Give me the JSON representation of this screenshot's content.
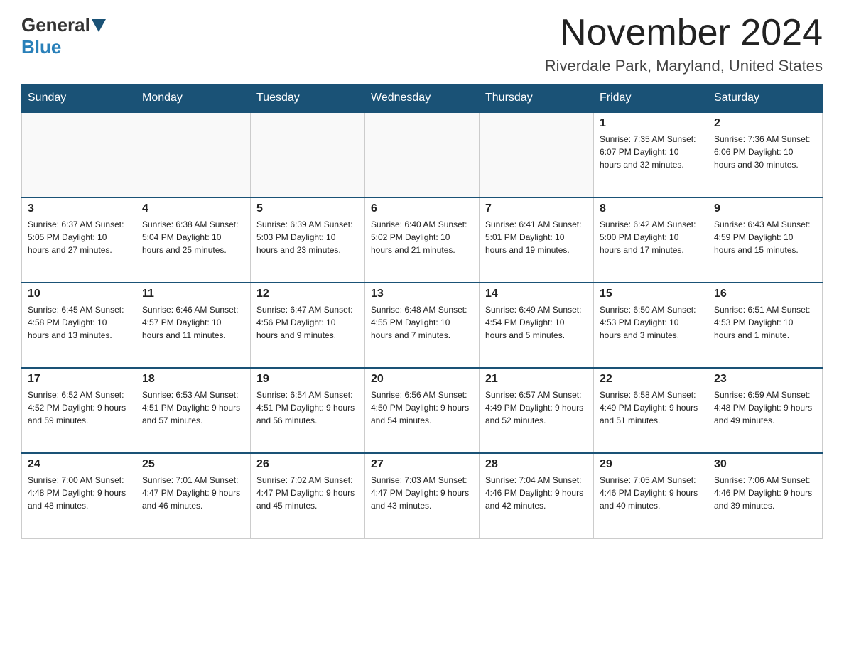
{
  "logo": {
    "general": "General",
    "blue": "Blue"
  },
  "title": {
    "month": "November 2024",
    "location": "Riverdale Park, Maryland, United States"
  },
  "weekdays": [
    "Sunday",
    "Monday",
    "Tuesday",
    "Wednesday",
    "Thursday",
    "Friday",
    "Saturday"
  ],
  "weeks": [
    [
      {
        "day": "",
        "info": ""
      },
      {
        "day": "",
        "info": ""
      },
      {
        "day": "",
        "info": ""
      },
      {
        "day": "",
        "info": ""
      },
      {
        "day": "",
        "info": ""
      },
      {
        "day": "1",
        "info": "Sunrise: 7:35 AM\nSunset: 6:07 PM\nDaylight: 10 hours and 32 minutes."
      },
      {
        "day": "2",
        "info": "Sunrise: 7:36 AM\nSunset: 6:06 PM\nDaylight: 10 hours and 30 minutes."
      }
    ],
    [
      {
        "day": "3",
        "info": "Sunrise: 6:37 AM\nSunset: 5:05 PM\nDaylight: 10 hours and 27 minutes."
      },
      {
        "day": "4",
        "info": "Sunrise: 6:38 AM\nSunset: 5:04 PM\nDaylight: 10 hours and 25 minutes."
      },
      {
        "day": "5",
        "info": "Sunrise: 6:39 AM\nSunset: 5:03 PM\nDaylight: 10 hours and 23 minutes."
      },
      {
        "day": "6",
        "info": "Sunrise: 6:40 AM\nSunset: 5:02 PM\nDaylight: 10 hours and 21 minutes."
      },
      {
        "day": "7",
        "info": "Sunrise: 6:41 AM\nSunset: 5:01 PM\nDaylight: 10 hours and 19 minutes."
      },
      {
        "day": "8",
        "info": "Sunrise: 6:42 AM\nSunset: 5:00 PM\nDaylight: 10 hours and 17 minutes."
      },
      {
        "day": "9",
        "info": "Sunrise: 6:43 AM\nSunset: 4:59 PM\nDaylight: 10 hours and 15 minutes."
      }
    ],
    [
      {
        "day": "10",
        "info": "Sunrise: 6:45 AM\nSunset: 4:58 PM\nDaylight: 10 hours and 13 minutes."
      },
      {
        "day": "11",
        "info": "Sunrise: 6:46 AM\nSunset: 4:57 PM\nDaylight: 10 hours and 11 minutes."
      },
      {
        "day": "12",
        "info": "Sunrise: 6:47 AM\nSunset: 4:56 PM\nDaylight: 10 hours and 9 minutes."
      },
      {
        "day": "13",
        "info": "Sunrise: 6:48 AM\nSunset: 4:55 PM\nDaylight: 10 hours and 7 minutes."
      },
      {
        "day": "14",
        "info": "Sunrise: 6:49 AM\nSunset: 4:54 PM\nDaylight: 10 hours and 5 minutes."
      },
      {
        "day": "15",
        "info": "Sunrise: 6:50 AM\nSunset: 4:53 PM\nDaylight: 10 hours and 3 minutes."
      },
      {
        "day": "16",
        "info": "Sunrise: 6:51 AM\nSunset: 4:53 PM\nDaylight: 10 hours and 1 minute."
      }
    ],
    [
      {
        "day": "17",
        "info": "Sunrise: 6:52 AM\nSunset: 4:52 PM\nDaylight: 9 hours and 59 minutes."
      },
      {
        "day": "18",
        "info": "Sunrise: 6:53 AM\nSunset: 4:51 PM\nDaylight: 9 hours and 57 minutes."
      },
      {
        "day": "19",
        "info": "Sunrise: 6:54 AM\nSunset: 4:51 PM\nDaylight: 9 hours and 56 minutes."
      },
      {
        "day": "20",
        "info": "Sunrise: 6:56 AM\nSunset: 4:50 PM\nDaylight: 9 hours and 54 minutes."
      },
      {
        "day": "21",
        "info": "Sunrise: 6:57 AM\nSunset: 4:49 PM\nDaylight: 9 hours and 52 minutes."
      },
      {
        "day": "22",
        "info": "Sunrise: 6:58 AM\nSunset: 4:49 PM\nDaylight: 9 hours and 51 minutes."
      },
      {
        "day": "23",
        "info": "Sunrise: 6:59 AM\nSunset: 4:48 PM\nDaylight: 9 hours and 49 minutes."
      }
    ],
    [
      {
        "day": "24",
        "info": "Sunrise: 7:00 AM\nSunset: 4:48 PM\nDaylight: 9 hours and 48 minutes."
      },
      {
        "day": "25",
        "info": "Sunrise: 7:01 AM\nSunset: 4:47 PM\nDaylight: 9 hours and 46 minutes."
      },
      {
        "day": "26",
        "info": "Sunrise: 7:02 AM\nSunset: 4:47 PM\nDaylight: 9 hours and 45 minutes."
      },
      {
        "day": "27",
        "info": "Sunrise: 7:03 AM\nSunset: 4:47 PM\nDaylight: 9 hours and 43 minutes."
      },
      {
        "day": "28",
        "info": "Sunrise: 7:04 AM\nSunset: 4:46 PM\nDaylight: 9 hours and 42 minutes."
      },
      {
        "day": "29",
        "info": "Sunrise: 7:05 AM\nSunset: 4:46 PM\nDaylight: 9 hours and 40 minutes."
      },
      {
        "day": "30",
        "info": "Sunrise: 7:06 AM\nSunset: 4:46 PM\nDaylight: 9 hours and 39 minutes."
      }
    ]
  ]
}
